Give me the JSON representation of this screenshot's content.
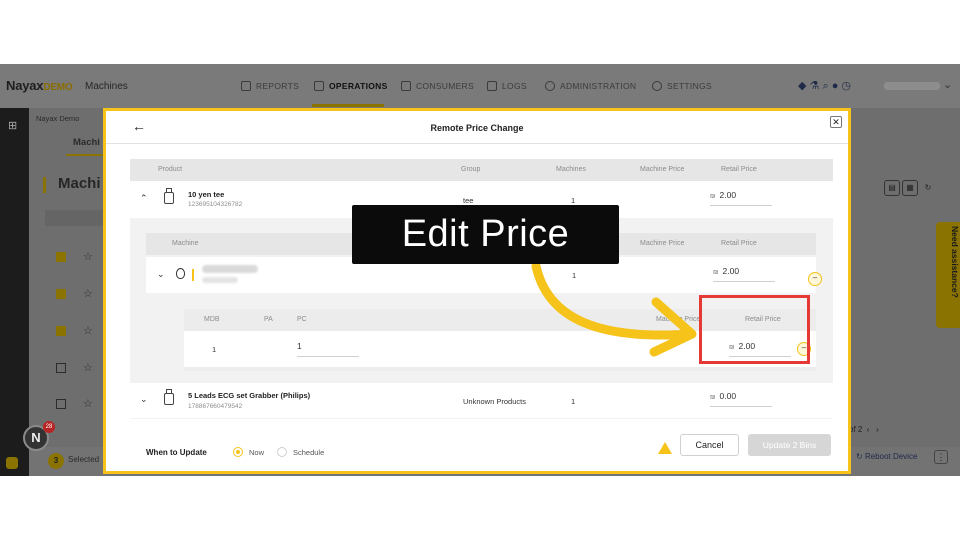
{
  "app": {
    "brand": "Nayax",
    "brand_suffix": "DEMO",
    "section": "Machines",
    "nav": [
      {
        "label": "REPORTS"
      },
      {
        "label": "OPERATIONS"
      },
      {
        "label": "CONSUMERS"
      },
      {
        "label": "LOGS"
      },
      {
        "label": "ADMINISTRATION"
      },
      {
        "label": "SETTINGS"
      }
    ],
    "breadcrumb": "Nayax Demo",
    "bg_tab": "Machi",
    "bg_title": "Machi",
    "need_assistance": "Need assistance?",
    "notification_count": "28",
    "selected_count": "3",
    "selected_label": "Selected",
    "reboot_label": "Reboot Device",
    "pager_text": "of 2"
  },
  "modal": {
    "title": "Remote Price Change",
    "columns": {
      "product": "Product",
      "group": "Group",
      "machines": "Machines",
      "machine_price": "Machine Price",
      "retail_price": "Retail Price"
    },
    "products": [
      {
        "name": "10 yen tee",
        "code": "123695104326782",
        "group": "tee",
        "machines": "1",
        "currency": "₪",
        "retail_price": "2.00"
      },
      {
        "name": "5 Leads ECG set Grabber (Philips)",
        "code": "178867660479542",
        "group": "Unknown Products",
        "machines": "1",
        "currency": "₪",
        "retail_price": "0.00"
      }
    ],
    "machine_table": {
      "col_machine": "Machine",
      "col_machine_price": "Machine Price",
      "col_retail_price": "Retail Price",
      "row": {
        "machines": "1",
        "currency": "₪",
        "retail_price": "2.00"
      }
    },
    "coil_table": {
      "col_mdb": "MDB",
      "col_pa": "PA",
      "col_pc": "PC",
      "col_machine_price": "Machine Price",
      "col_retail_price": "Retail Price",
      "row": {
        "mdb": "1",
        "pc": "1",
        "currency": "₪",
        "retail_price": "2.00"
      }
    },
    "footer": {
      "when_label": "When to Update",
      "option_now": "Now",
      "option_schedule": "Schedule",
      "selected_option": "Now",
      "cancel_label": "Cancel",
      "update_label": "Update 2 Bins"
    }
  },
  "tutorial": {
    "callout_text": "Edit Price",
    "highlight_color": "#e53935",
    "arrow_color": "#f5c31a"
  },
  "colors": {
    "accent": "#f5c31a",
    "highlight": "#e53935"
  }
}
